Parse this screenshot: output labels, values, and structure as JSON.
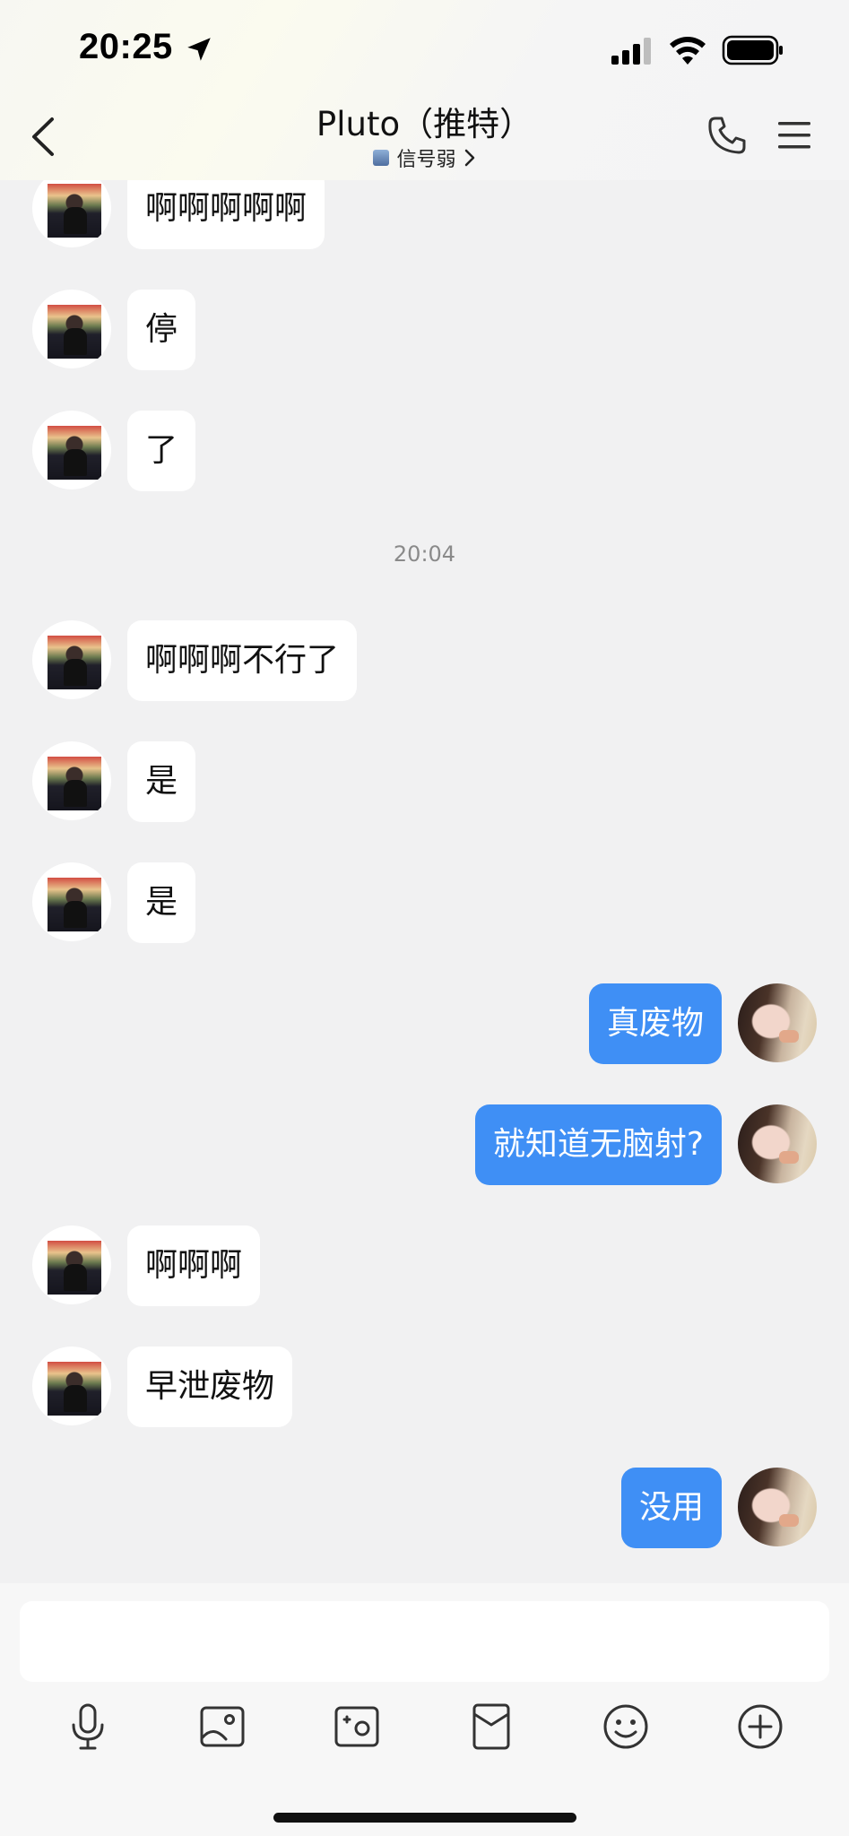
{
  "status_bar": {
    "time": "20:25",
    "icons": [
      "location-arrow-icon",
      "cellular-signal-icon",
      "wifi-icon",
      "battery-icon"
    ]
  },
  "header": {
    "title": "Pluto（推特）",
    "subtitle": "信号弱",
    "icons": [
      "back-chevron-icon",
      "phone-icon",
      "menu-icon"
    ]
  },
  "timestamp": "20:04",
  "messages": [
    {
      "side": "left",
      "text": "啊啊啊啊啊"
    },
    {
      "side": "left",
      "text": "停"
    },
    {
      "side": "left",
      "text": "了"
    },
    {
      "side": "left",
      "text": "啊啊啊不行了"
    },
    {
      "side": "left",
      "text": "是"
    },
    {
      "side": "left",
      "text": "是"
    },
    {
      "side": "right",
      "text": "真废物"
    },
    {
      "side": "right",
      "text": "就知道无脑射?"
    },
    {
      "side": "left",
      "text": "啊啊啊"
    },
    {
      "side": "left",
      "text": "早泄废物"
    },
    {
      "side": "right",
      "text": "没用"
    }
  ],
  "input": {
    "value": ""
  },
  "toolbar": {
    "icons": [
      "microphone-icon",
      "image-icon",
      "camera-icon",
      "red-packet-icon",
      "emoji-icon",
      "plus-icon"
    ]
  },
  "colors": {
    "background": "#f1f1f2",
    "outgoing_bubble": "#3f8ff5",
    "incoming_bubble": "#ffffff",
    "timestamp_text": "#8a8a8a"
  }
}
